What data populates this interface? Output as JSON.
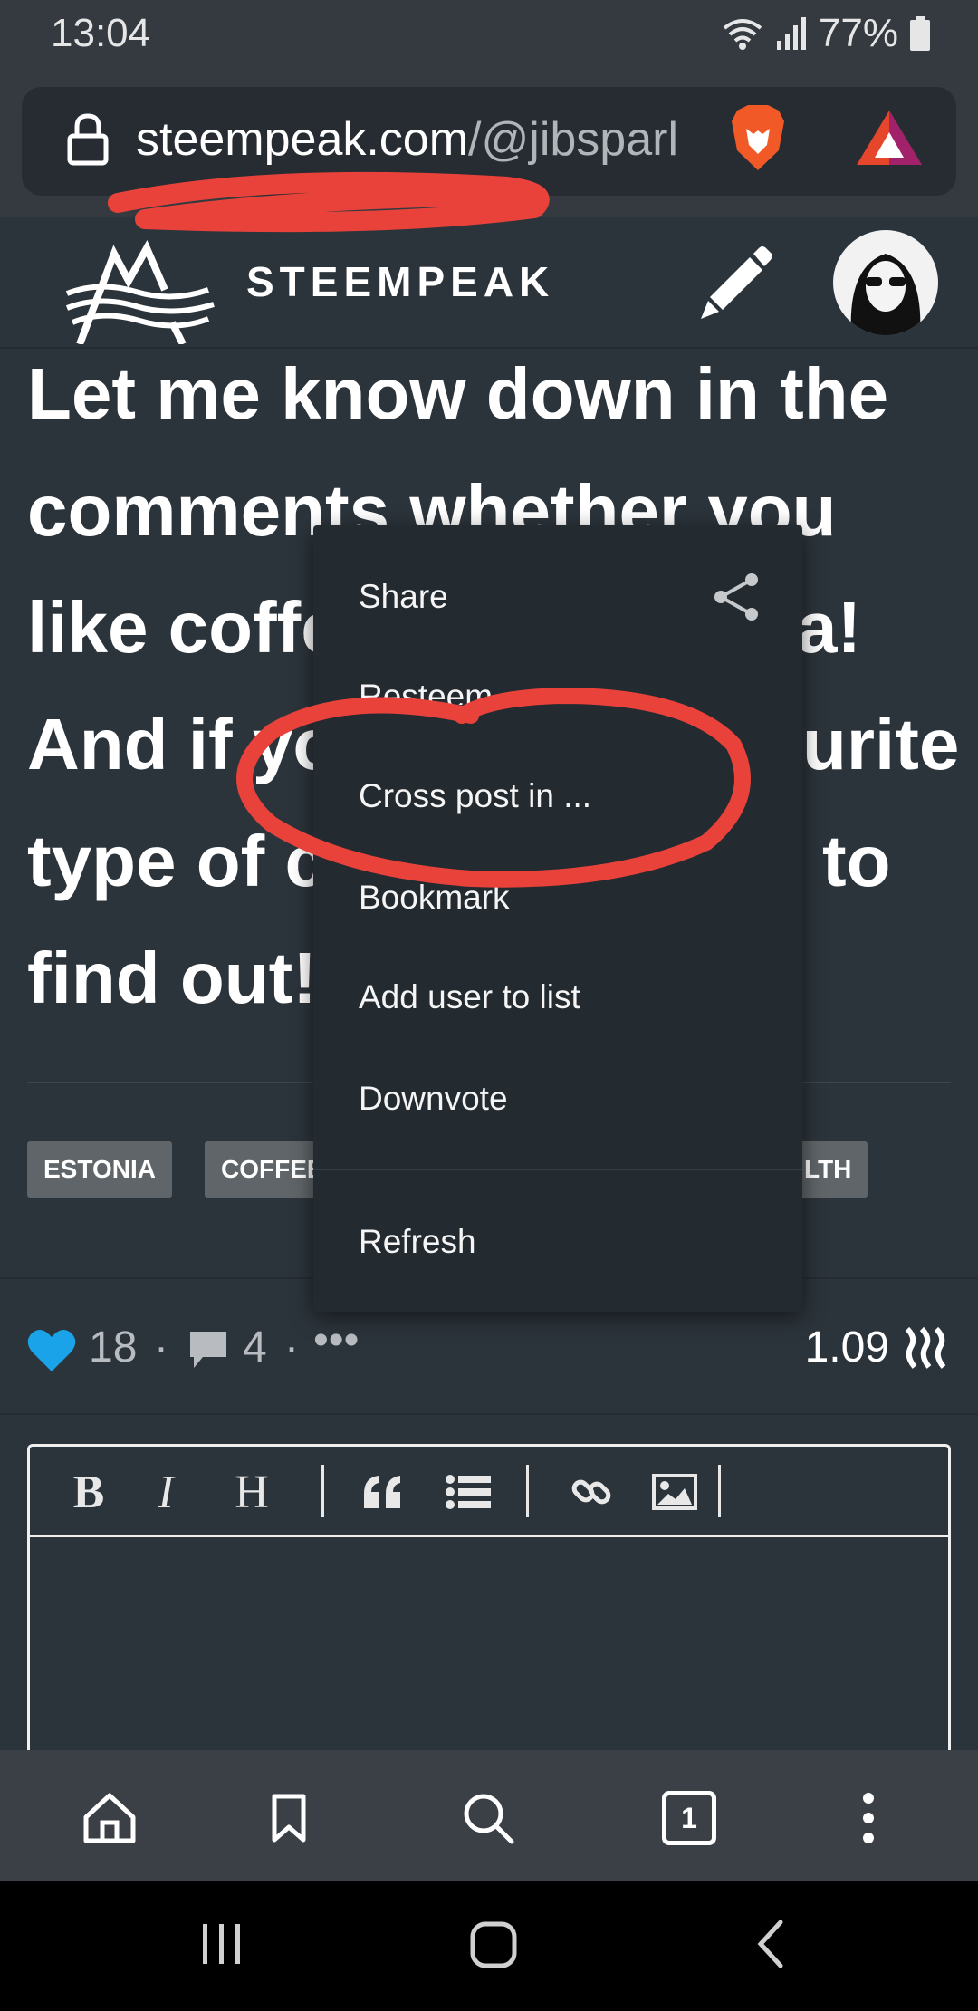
{
  "status_bar": {
    "time": "13:04",
    "battery": "77%"
  },
  "browser": {
    "url_host": "steempeak.com",
    "url_path": "/@jibsparl"
  },
  "site": {
    "logo_text": "STEEMPEAK"
  },
  "post": {
    "body": "Let me know down in the comments whether you like coffee or tea! And if you have a favourite type of coffee, I'd love to find out!",
    "visible_lines": [
      "Let me know down in the",
      "comments whether you",
      "like coffe",
      "a!",
      "And if yo",
      "urite",
      "type of c",
      "to",
      "find out!"
    ]
  },
  "tags": [
    "ESTONIA",
    "COFFEE",
    "LTH"
  ],
  "stats": {
    "votes": "18",
    "comments": "4",
    "more": "•••",
    "separator": "·",
    "payout": "1.09"
  },
  "context_menu": {
    "items": [
      "Share",
      "Resteem",
      "Cross post in ...",
      "Bookmark",
      "Add user to list",
      "Downvote",
      "Refresh"
    ],
    "highlighted": "Cross post in ..."
  },
  "editor_toolbar": {
    "bold": "B",
    "italic": "I",
    "heading": "H"
  },
  "bottom_nav": {
    "tab_count": "1"
  },
  "colors": {
    "background": "#2c343b",
    "menu": "#232a30",
    "annotation": "#e8423b",
    "heart": "#1aa3e8"
  }
}
